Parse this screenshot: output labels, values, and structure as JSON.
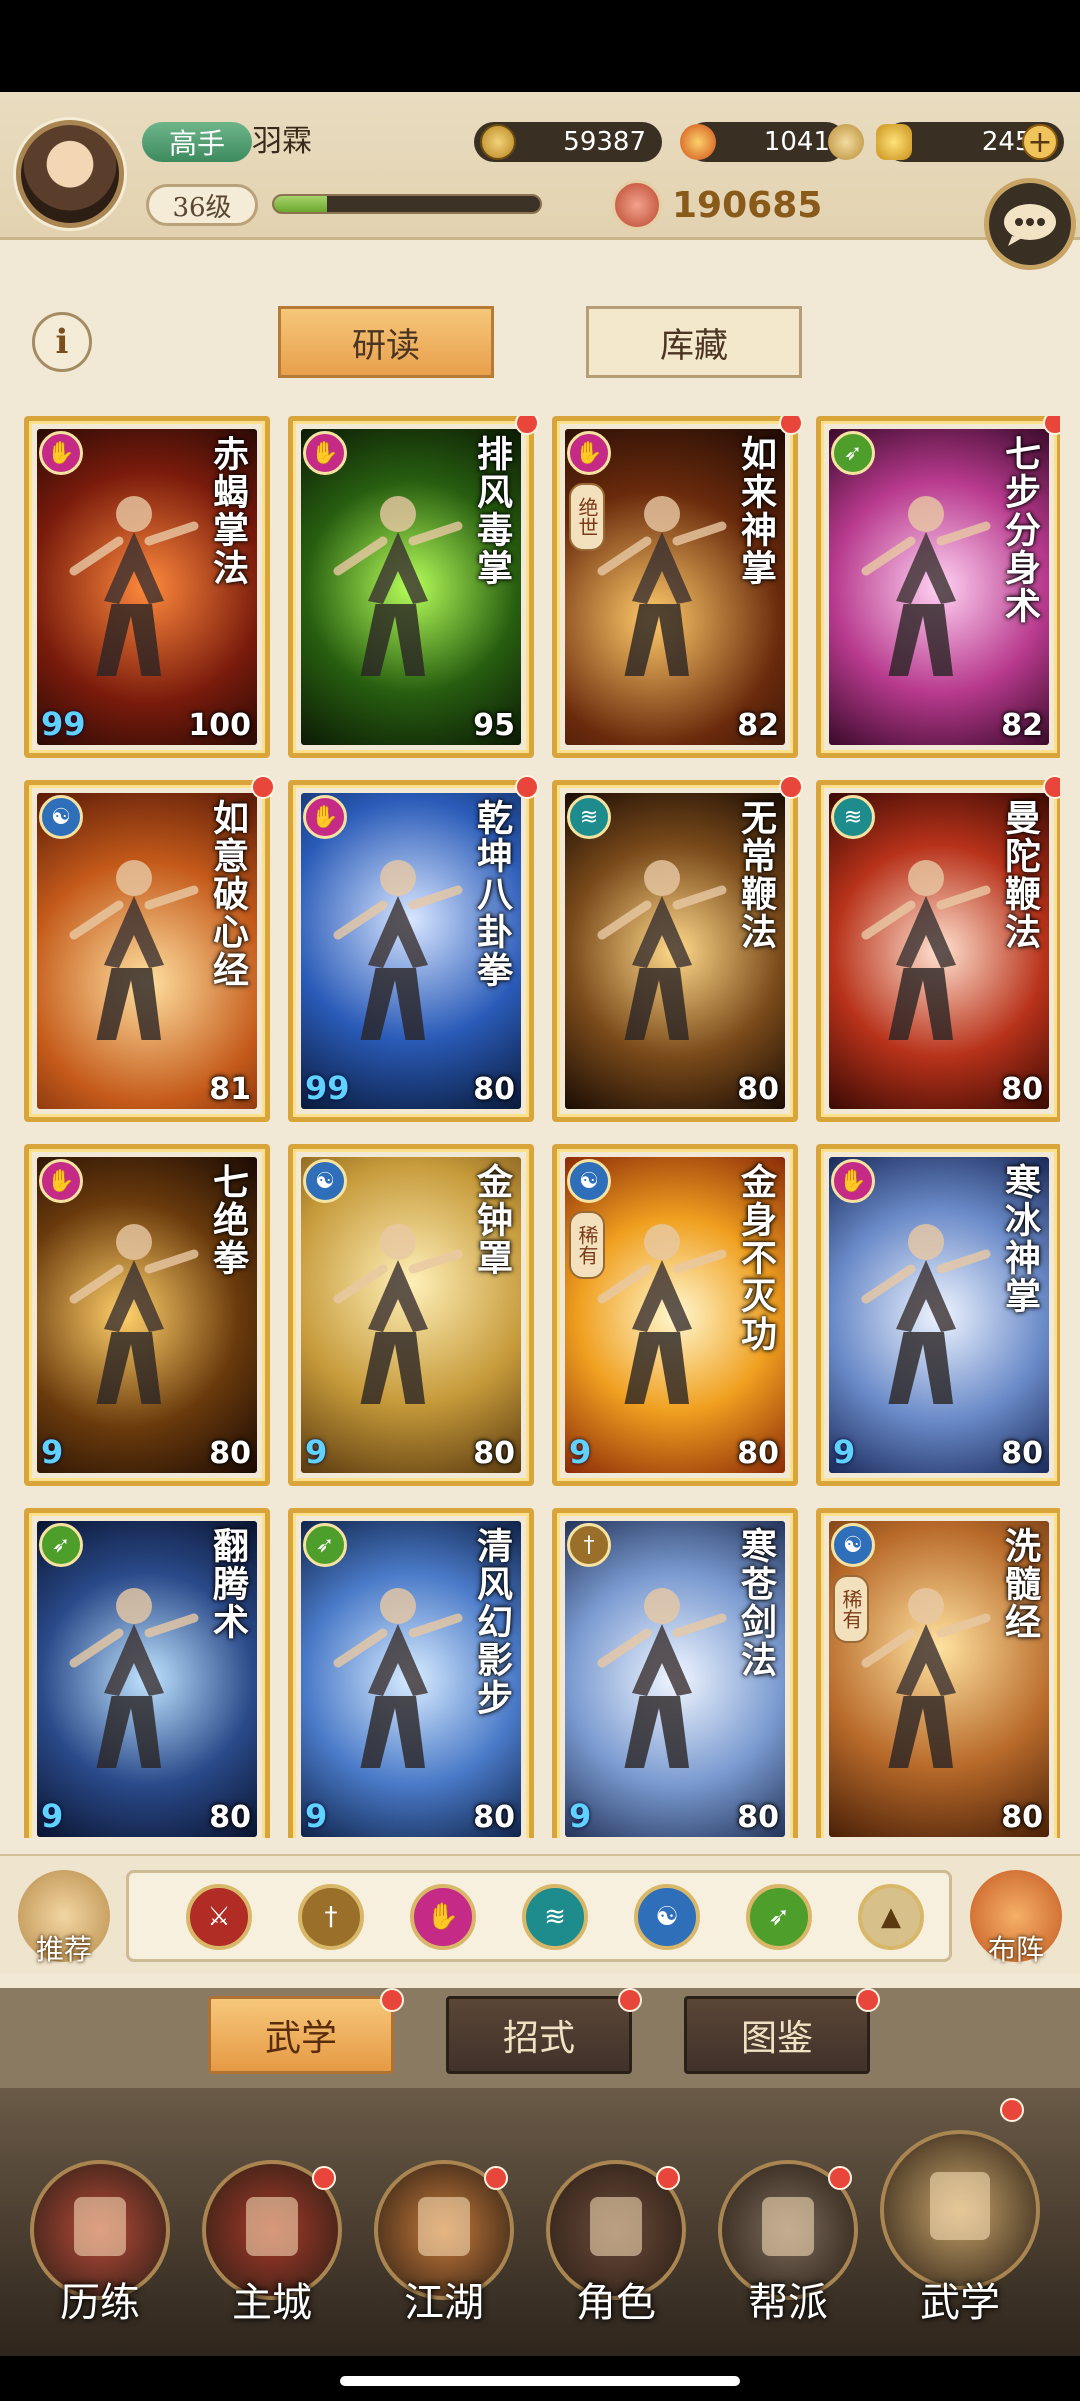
{
  "player": {
    "rank": "高手",
    "name": "羽霖",
    "level": "36级",
    "xp_fraction": 0.2
  },
  "resources": {
    "copper": "59387",
    "stamina": "1041",
    "gold": "2459",
    "power": "190685"
  },
  "tabs": {
    "read": "研读",
    "store": "库藏"
  },
  "info_icon": "i",
  "cards": [
    {
      "name": "赤蝎掌法",
      "level": "100",
      "type": "palm",
      "quote": "99",
      "dot": false,
      "tag": ""
    },
    {
      "name": "排风毒掌",
      "level": "95",
      "type": "palm",
      "quote": "",
      "dot": true,
      "tag": ""
    },
    {
      "name": "如来神掌",
      "level": "82",
      "type": "palm",
      "quote": "",
      "dot": true,
      "tag": "绝世"
    },
    {
      "name": "七步分身术",
      "level": "82",
      "type": "agility",
      "quote": "",
      "dot": true,
      "tag": ""
    },
    {
      "name": "如意破心经",
      "level": "81",
      "type": "inner",
      "quote": "",
      "dot": true,
      "tag": ""
    },
    {
      "name": "乾坤八卦拳",
      "level": "80",
      "type": "palm",
      "quote": "99",
      "dot": true,
      "tag": ""
    },
    {
      "name": "无常鞭法",
      "level": "80",
      "type": "whip",
      "quote": "",
      "dot": true,
      "tag": ""
    },
    {
      "name": "曼陀鞭法",
      "level": "80",
      "type": "whip",
      "quote": "",
      "dot": true,
      "tag": ""
    },
    {
      "name": "七绝拳",
      "level": "80",
      "type": "palm",
      "quote": "9",
      "dot": false,
      "tag": ""
    },
    {
      "name": "金钟罩",
      "level": "80",
      "type": "inner",
      "quote": "9",
      "dot": false,
      "tag": ""
    },
    {
      "name": "金身不灭功",
      "level": "80",
      "type": "inner",
      "quote": "9",
      "dot": false,
      "tag": "稀有"
    },
    {
      "name": "寒冰神掌",
      "level": "80",
      "type": "palm",
      "quote": "9",
      "dot": false,
      "tag": ""
    },
    {
      "name": "翻腾术",
      "level": "80",
      "type": "agility",
      "quote": "9",
      "dot": false,
      "tag": ""
    },
    {
      "name": "清风幻影步",
      "level": "80",
      "type": "agility",
      "quote": "9",
      "dot": false,
      "tag": ""
    },
    {
      "name": "寒苍剑法",
      "level": "80",
      "type": "sword",
      "quote": "9",
      "dot": false,
      "tag": ""
    },
    {
      "name": "洗髓经",
      "level": "80",
      "type": "inner",
      "quote": "",
      "dot": false,
      "tag": "稀有"
    }
  ],
  "filter": {
    "recommend": "推荐",
    "formation": "布阵",
    "icons": [
      "blade-icon",
      "sword-icon",
      "palm-icon",
      "whip-icon",
      "inner-icon",
      "agility-icon",
      "hidden-weapon-icon"
    ]
  },
  "subtabs": {
    "wuxue": "武学",
    "zhaoshi": "招式",
    "tujian": "图鉴"
  },
  "nav": [
    "历练",
    "主城",
    "江湖",
    "角色",
    "帮派",
    "武学"
  ],
  "colors": {
    "palm": "#c42a86",
    "agility": "#4e9e2b",
    "inner": "#2f6fb9",
    "whip": "#1e8b8c",
    "sword": "#9a6f2a",
    "blade": "#b02c24",
    "accent_gold": "#d9a53b"
  }
}
